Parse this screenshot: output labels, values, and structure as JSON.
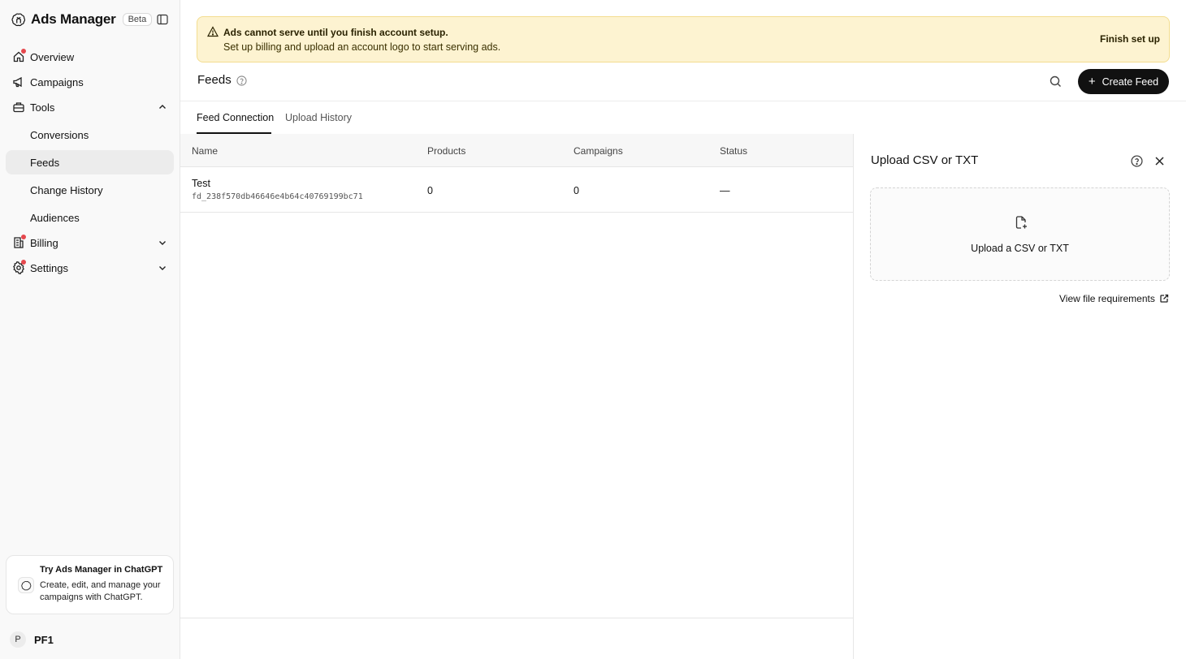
{
  "app": {
    "title": "Ads Manager",
    "badge": "Beta"
  },
  "sidebar": {
    "items": [
      {
        "label": "Overview",
        "icon": "home-icon",
        "has_dot": true
      },
      {
        "label": "Campaigns",
        "icon": "megaphone-icon",
        "has_dot": false
      },
      {
        "label": "Tools",
        "icon": "toolbox-icon",
        "expanded": true
      }
    ],
    "tools_children": [
      "Conversions",
      "Feeds",
      "Change History",
      "Audiences"
    ],
    "active_child": "Feeds",
    "billing": {
      "label": "Billing",
      "icon": "receipt-icon",
      "has_dot": true
    },
    "settings": {
      "label": "Settings",
      "icon": "gear-icon",
      "has_dot": true
    },
    "promo": {
      "title": "Try Ads Manager in ChatGPT",
      "description": "Create, edit, and manage your campaigns with ChatGPT."
    },
    "account": {
      "initial": "P",
      "name": "PF1"
    }
  },
  "banner": {
    "title": "Ads cannot serve until you finish account setup.",
    "text": "Set up billing and upload an account logo to start serving ads.",
    "action": "Finish set up",
    "color": "#fdf3d1"
  },
  "header": {
    "title": "Feeds",
    "create_button": "Create Feed"
  },
  "tabs": [
    {
      "label": "Feed Connection",
      "active": true
    },
    {
      "label": "Upload History",
      "active": false
    }
  ],
  "table": {
    "columns": [
      "Name",
      "Products",
      "Campaigns",
      "Status"
    ],
    "rows": [
      {
        "name": "Test",
        "id": "fd_238f570db46646e4b64c40769199bc71",
        "products": "0",
        "campaigns": "0",
        "status": "—"
      }
    ]
  },
  "panel": {
    "title": "Upload CSV or TXT",
    "dropzone_label": "Upload a CSV or TXT",
    "requirements_link": "View file requirements"
  }
}
